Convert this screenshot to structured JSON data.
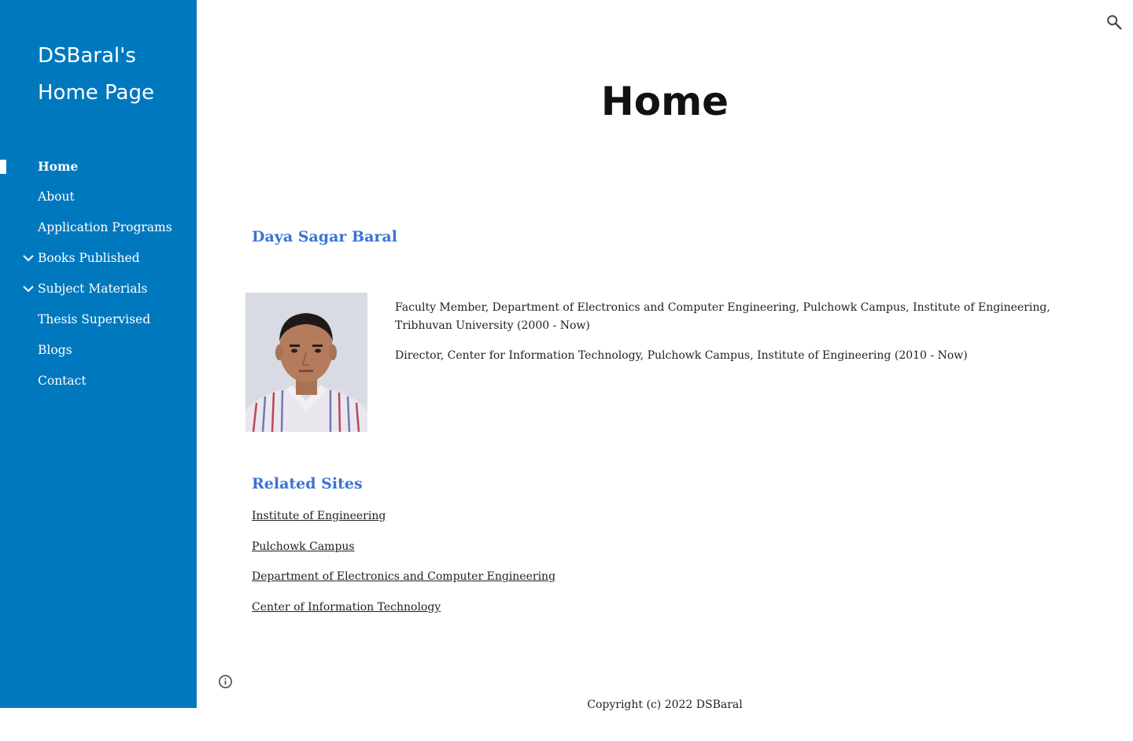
{
  "sidebar": {
    "site_title": "DSBaral's Home Page",
    "items": [
      {
        "label": "Home",
        "active": true,
        "expandable": false
      },
      {
        "label": "About",
        "active": false,
        "expandable": false
      },
      {
        "label": "Application Programs",
        "active": false,
        "expandable": false
      },
      {
        "label": "Books Published",
        "active": false,
        "expandable": true
      },
      {
        "label": "Subject Materials",
        "active": false,
        "expandable": true
      },
      {
        "label": "Thesis Supervised",
        "active": false,
        "expandable": false
      },
      {
        "label": "Blogs",
        "active": false,
        "expandable": false
      },
      {
        "label": "Contact",
        "active": false,
        "expandable": false
      }
    ]
  },
  "header": {
    "search_icon": "search-icon"
  },
  "main": {
    "page_title": "Home",
    "name": "Daya Sagar Baral",
    "bio": [
      "Faculty Member, Department of Electronics and Computer Engineering, Pulchowk Campus, Institute of Engineering, Tribhuvan University (2000 - Now)",
      "Director, Center for Information Technology, Pulchowk Campus, Institute of Engineering (2010 - Now)"
    ],
    "related_heading": "Related Sites",
    "related_links": [
      "Institute of Engineering",
      "Pulchowk Campus",
      "Department of Electronics and Computer Engineering",
      "Center of Information Technology"
    ]
  },
  "footer": {
    "copyright": "Copyright (c) 2022 DSBaral",
    "info_icon": "info-icon"
  },
  "colors": {
    "sidebar_bg": "#0078be",
    "heading_accent": "#3b73d4",
    "text": "#212121"
  }
}
